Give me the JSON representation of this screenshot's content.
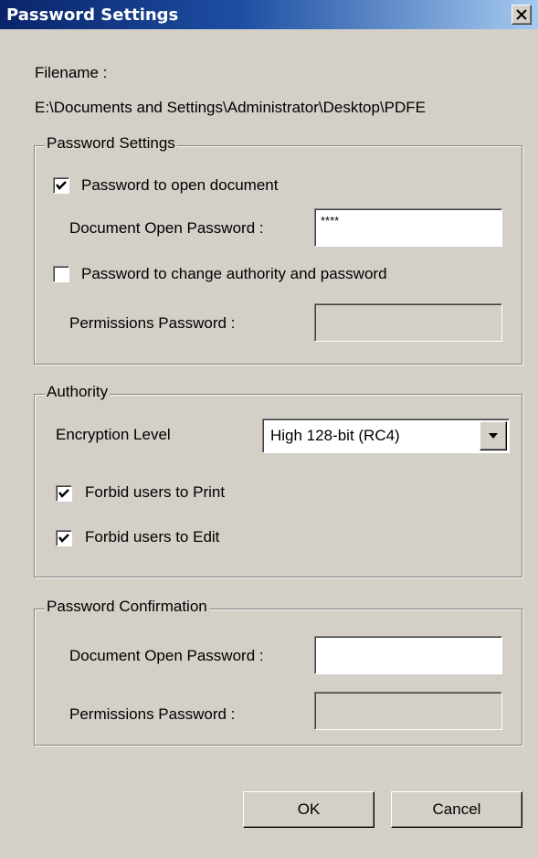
{
  "window": {
    "title": "Password Settings"
  },
  "file": {
    "label": "Filename :",
    "path": "E:\\Documents and Settings\\Administrator\\Desktop\\PDFE"
  },
  "password_settings": {
    "legend": "Password Settings",
    "open_checkbox_label": "Password to open document",
    "open_checked": true,
    "open_password_label": "Document Open Password :",
    "open_password_value": "****",
    "change_checkbox_label": "Password to change authority and password",
    "change_checked": false,
    "permissions_label": "Permissions Password :",
    "permissions_value": ""
  },
  "authority": {
    "legend": "Authority",
    "encryption_label": "Encryption Level",
    "encryption_selected": "High 128-bit (RC4)",
    "forbid_print_label": "Forbid users to Print",
    "forbid_print_checked": true,
    "forbid_edit_label": "Forbid users to Edit",
    "forbid_edit_checked": true
  },
  "confirmation": {
    "legend": "Password Confirmation",
    "open_password_label": "Document Open Password :",
    "open_password_value": "",
    "permissions_label": "Permissions Password :",
    "permissions_value": ""
  },
  "buttons": {
    "ok": "OK",
    "cancel": "Cancel"
  },
  "icons": {
    "close": "close-icon",
    "check": "checkmark-icon",
    "dropdown": "chevron-down-icon"
  },
  "colors": {
    "title_bar": "#0a246a",
    "dialog_bg": "#d4d0c8"
  }
}
